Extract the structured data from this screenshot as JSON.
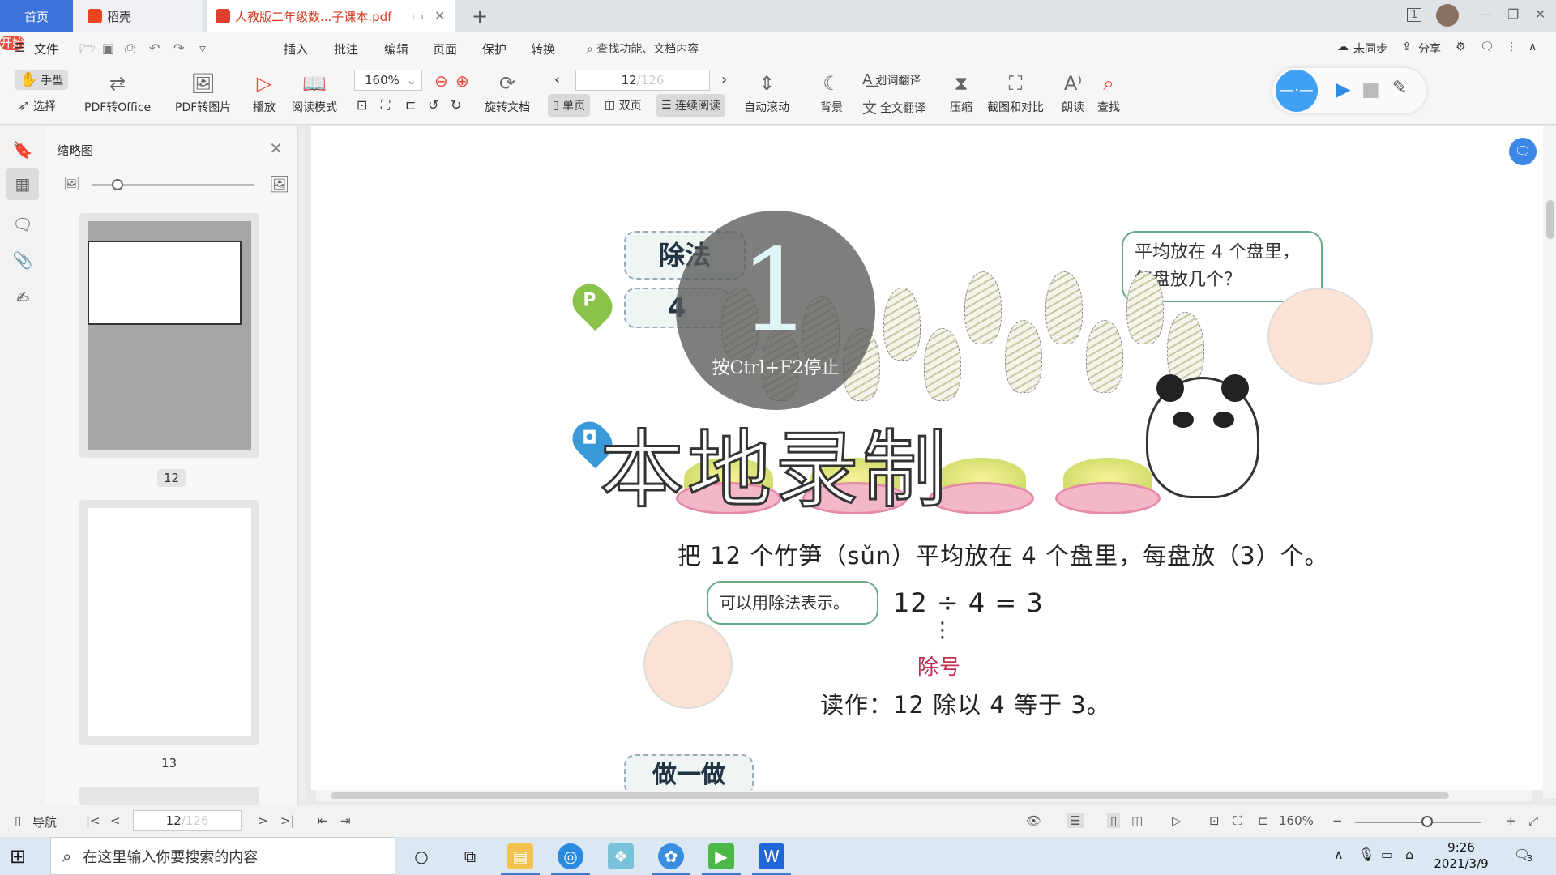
{
  "tabs": {
    "home": "首页",
    "daoke": "稻壳",
    "pdf": "人教版二年级数...子课本.pdf",
    "new_tab": "+",
    "window_count": "1"
  },
  "menu": {
    "file": "文件",
    "start": "开始",
    "items": [
      "插入",
      "批注",
      "编辑",
      "页面",
      "保护",
      "转换"
    ],
    "search_placeholder": "查找功能、文档内容",
    "unsynced": "未同步",
    "share": "分享"
  },
  "toolbar": {
    "hand": "手型",
    "select": "选择",
    "pdf_to_office": "PDF转Office",
    "pdf_to_image": "PDF转图片",
    "play": "播放",
    "read_mode": "阅读模式",
    "zoom": "160%",
    "page_current": "12",
    "page_total": "/126",
    "rotate": "旋转文档",
    "single_page": "单页",
    "double_page": "双页",
    "continuous": "连续阅读",
    "auto_scroll": "自动滚动",
    "background": "背景",
    "word_translate": "划词翻译",
    "full_translate": "全文翻译",
    "compress": "压缩",
    "screenshot_compare": "截图和对比",
    "read_aloud": "朗读",
    "find": "查找"
  },
  "thumbs": {
    "title": "缩略图",
    "pages": [
      "12",
      "13"
    ]
  },
  "doc": {
    "tag_division": "除法",
    "tag_number": "4",
    "pin_p": "P",
    "bubble_top": [
      "平均放在 4 个盘里，",
      "每盘放几个？"
    ],
    "sentence": "把 12 个竹笋（sǔn）平均放在 4 个盘里，每盘放（3）个。",
    "bubble_bottom": "可以用除法表示。",
    "equation": "12 ÷ 4 = 3",
    "divider_dots": "⋮",
    "divider_label": "除号",
    "reading": "读作：12 除以 4 等于 3。",
    "tag_try": "做一做"
  },
  "recording": {
    "countdown": "1",
    "hint": "按Ctrl+F2停止",
    "big_text": "本地录制"
  },
  "status": {
    "nav": "导航",
    "page_current": "12",
    "page_total": "/126",
    "zoom": "160%"
  },
  "taskbar": {
    "search_placeholder": "在这里输入你要搜索的内容",
    "time": "9:26",
    "date": "2021/3/9",
    "notifications": "3"
  },
  "colors": {
    "accent_blue": "#3b73d8",
    "start_red": "#e94e3c",
    "rec_blue": "#3ea1f4"
  }
}
